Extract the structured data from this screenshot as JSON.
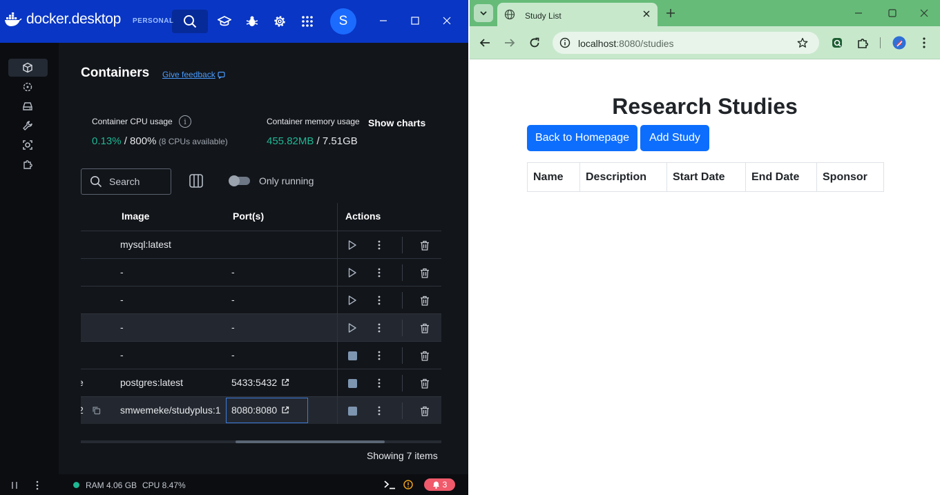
{
  "docker": {
    "brand": "docker.desktop",
    "badge": "PERSONAL",
    "avatar_letter": "S",
    "page_title": "Containers",
    "feedback_label": "Give feedback",
    "cpu": {
      "label": "Container CPU usage",
      "value": "0.13%",
      "total": " / 800%",
      "note": " (8 CPUs available)"
    },
    "memory": {
      "label": "Container memory usage",
      "value": "455.82MB",
      "total": " / 7.51GB"
    },
    "show_charts": "Show charts",
    "search_placeholder": "Search",
    "only_running_label": "Only running",
    "columns": {
      "image": "Image",
      "ports": "Port(s)",
      "actions": "Actions"
    },
    "rows": [
      {
        "prefix": "",
        "image": "mysql:latest",
        "ports": "",
        "state": "stopped"
      },
      {
        "prefix": "",
        "image": "-",
        "ports": "-",
        "state": "stopped"
      },
      {
        "prefix": "",
        "image": "-",
        "ports": "-",
        "state": "stopped"
      },
      {
        "prefix": "",
        "image": "-",
        "ports": "-",
        "state": "stopped"
      },
      {
        "prefix": "",
        "image": "-",
        "ports": "-",
        "state": "running"
      },
      {
        "prefix": "e",
        "image": "postgres:latest",
        "ports": "5433:5432",
        "state": "running"
      },
      {
        "prefix": "2",
        "image": "smwemeke/studyplus:1",
        "ports": "8080:8080",
        "state": "running"
      }
    ],
    "showing_label": "Showing 7 items",
    "status": {
      "ram": "RAM 4.06 GB",
      "cpu": "CPU 8.47%",
      "notifications": "3"
    },
    "accent_color": "#1fb793",
    "brand_color": "#0936c4"
  },
  "chrome": {
    "tab_title": "Study List",
    "url_host": "localhost",
    "url_rest": ":8080/studies",
    "theme_color": "#66bb78"
  },
  "page": {
    "heading": "Research Studies",
    "back_button": "Back to Homepage",
    "add_button": "Add Study",
    "table_headers": [
      "Name",
      "Description",
      "Start Date",
      "End Date",
      "Sponsor"
    ],
    "button_color": "#0d6efd"
  }
}
